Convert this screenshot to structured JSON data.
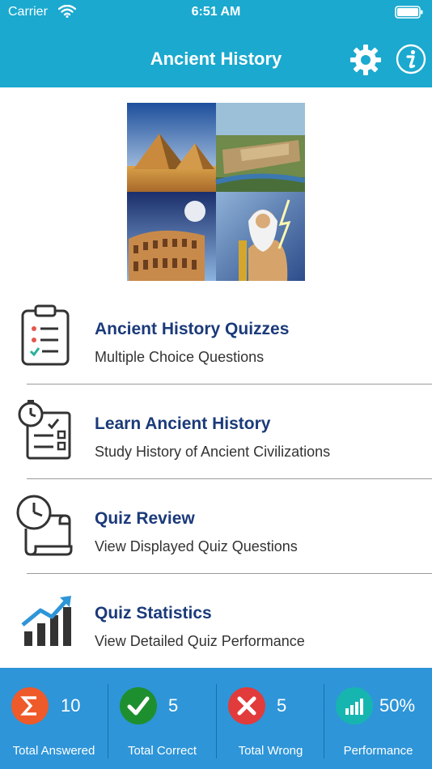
{
  "status_bar": {
    "carrier": "Carrier",
    "time": "6:51 AM"
  },
  "header": {
    "title": "Ancient History",
    "background": "#1ba9cf"
  },
  "menu": [
    {
      "title": "Ancient History Quizzes",
      "subtitle": "Multiple Choice Questions",
      "icon": "quiz-checklist-icon"
    },
    {
      "title": "Learn Ancient History",
      "subtitle": "Study History of Ancient Civilizations",
      "icon": "study-stopwatch-icon"
    },
    {
      "title": "Quiz Review",
      "subtitle": "View Displayed Quiz Questions",
      "icon": "review-scroll-icon"
    },
    {
      "title": "Quiz Statistics",
      "subtitle": "View Detailed Quiz Performance",
      "icon": "bar-chart-icon"
    }
  ],
  "stats": [
    {
      "value": "10",
      "label": "Total Answered",
      "icon": "sigma-icon",
      "color": "#ef5a2a"
    },
    {
      "value": "5",
      "label": "Total Correct",
      "icon": "checkmark-icon",
      "color": "#1e8f2e"
    },
    {
      "value": "5",
      "label": "Total Wrong",
      "icon": "x-icon",
      "color": "#e23b3b"
    },
    {
      "value": "50%",
      "label": "Performance",
      "icon": "bars-icon",
      "color": "#17b5b0"
    }
  ],
  "colors": {
    "accent": "#1ba9cf",
    "footer": "#2e95d8",
    "menu_title": "#1b3a7a"
  }
}
